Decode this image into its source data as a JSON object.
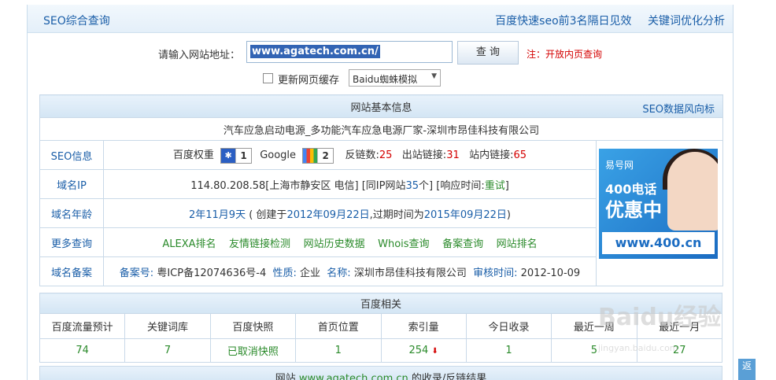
{
  "header": {
    "title": "SEO综合查询",
    "link1": "百度快速seo前3名隔日见效",
    "link2": "关键词优化分析"
  },
  "search": {
    "label": "请输入网站地址：",
    "value": "www.agatech.com.cn/",
    "button": "查 询",
    "note": "注：开放内页查询"
  },
  "options": {
    "cache_label": "更新网页缓存",
    "select_value": "Baidu蜘蛛模拟"
  },
  "basic": {
    "header": "网站基本信息",
    "header_link": "SEO数据风向标",
    "site_title": "汽车应急启动电源_多功能汽车应急电源厂家-深圳市昂佳科技有限公司",
    "rows": {
      "seo_label": "SEO信息",
      "baidu_weight_label": "百度权重",
      "baidu_weight": "1",
      "google_label": "Google",
      "google_pr": "2",
      "backlinks_label": "反链数:",
      "backlinks": "25",
      "outlinks_label": "出站链接:",
      "outlinks": "31",
      "inlinks_label": "站内链接:",
      "inlinks": "65",
      "ip_label": "域名IP",
      "ip": "114.80.208.58[上海市静安区 电信]",
      "same_ip_pre": "[同IP网站",
      "same_ip": "35",
      "same_ip_post": "个]",
      "resp_pre": "[响应时间:",
      "resp": "重试",
      "resp_post": "]",
      "age_label": "域名年龄",
      "age": "2年11月9天",
      "age_mid1": "( 创建于",
      "created": "2012年09月22日",
      "age_mid2": ",过期时间为",
      "expires": "2015年09月22日",
      "age_end": ")",
      "more_label": "更多查询",
      "more_links": [
        "ALEXA排名",
        "友情链接检测",
        "网站历史数据",
        "Whois查询",
        "备案查询",
        "网站排名"
      ],
      "icp_label": "域名备案",
      "icp_no_label": "备案号:",
      "icp_no": "粤ICP备12074636号-4",
      "nature_label": "性质:",
      "nature": "企业",
      "name_label": "名称:",
      "name": "深圳市昂佳科技有限公司",
      "audit_label": "审核时间:",
      "audit": "2012-10-09"
    }
  },
  "ad": {
    "brand": "易号网",
    "line1": "400电话",
    "line2": "优惠中",
    "url": "www.400.cn"
  },
  "baidu": {
    "header": "百度相关",
    "columns": [
      "百度流量预计",
      "关键词库",
      "百度快照",
      "首页位置",
      "索引量",
      "今日收录",
      "最近一周",
      "最近一月"
    ],
    "values": [
      "74",
      "7",
      "已取消快照",
      "1",
      "254",
      "1",
      "5",
      "27"
    ]
  },
  "bottom": {
    "pre": "网站",
    "domain": "www.agatech.com.cn",
    "post": "的收录/反链结果"
  },
  "back_top": "返",
  "watermark": "Baidu经验",
  "watermark_url": "jingyan.baidu.com",
  "colors": {
    "link": "#1a5ea8",
    "red": "#d40000",
    "green": "#2a8a2a"
  }
}
